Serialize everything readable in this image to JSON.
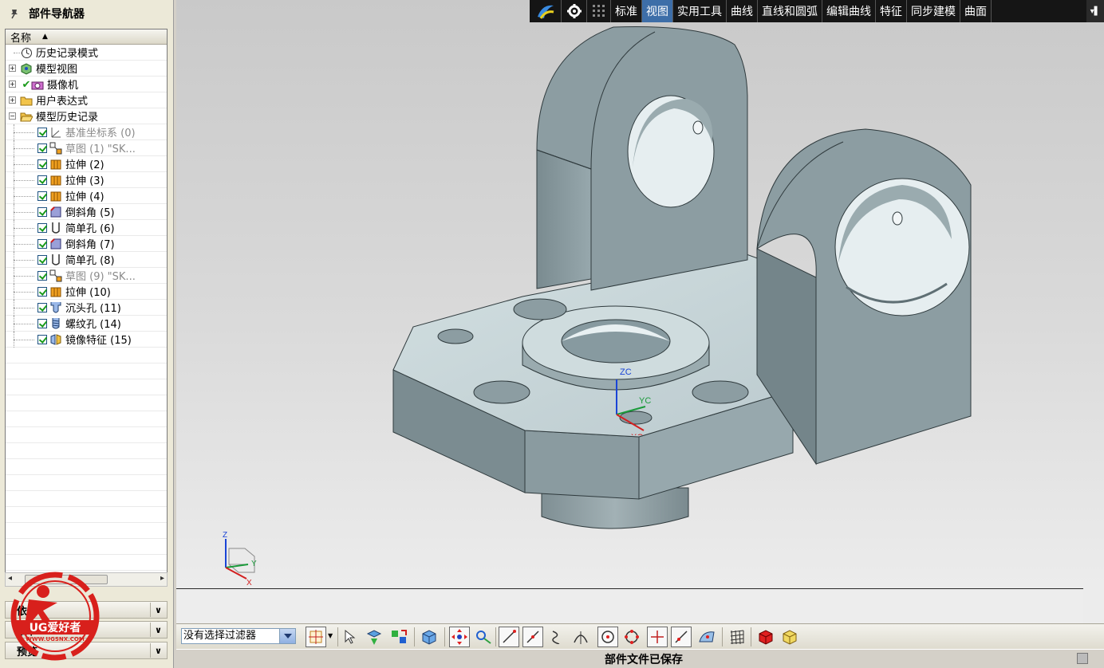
{
  "navigator": {
    "title": "部件导航器",
    "column_name": "名称",
    "items": [
      {
        "label": "历史记录模式",
        "icon": "clock-icon",
        "level": 0,
        "expander": "",
        "checked": false,
        "gray": false
      },
      {
        "label": "模型视图",
        "icon": "model-view-icon",
        "level": 0,
        "expander": "+",
        "checked": false,
        "gray": false
      },
      {
        "label": "摄像机",
        "icon": "camera-icon",
        "level": 0,
        "expander": "+",
        "checked": false,
        "gray": false
      },
      {
        "label": "用户表达式",
        "icon": "folder-icon",
        "level": 0,
        "expander": "+",
        "checked": false,
        "gray": false
      },
      {
        "label": "模型历史记录",
        "icon": "folder-open-icon",
        "level": 0,
        "expander": "-",
        "checked": false,
        "gray": false
      },
      {
        "label": "基准坐标系 (0)",
        "icon": "datum-csys-icon",
        "level": 1,
        "expander": "",
        "checked": true,
        "gray": true
      },
      {
        "label": "草图 (1) \"SK...",
        "icon": "sketch-icon",
        "level": 1,
        "expander": "",
        "checked": true,
        "gray": true
      },
      {
        "label": "拉伸 (2)",
        "icon": "extrude-icon",
        "level": 1,
        "expander": "",
        "checked": true,
        "gray": false
      },
      {
        "label": "拉伸 (3)",
        "icon": "extrude-icon",
        "level": 1,
        "expander": "",
        "checked": true,
        "gray": false
      },
      {
        "label": "拉伸 (4)",
        "icon": "extrude-icon",
        "level": 1,
        "expander": "",
        "checked": true,
        "gray": false
      },
      {
        "label": "倒斜角 (5)",
        "icon": "chamfer-icon",
        "level": 1,
        "expander": "",
        "checked": true,
        "gray": false
      },
      {
        "label": "简单孔 (6)",
        "icon": "simple-hole-icon",
        "level": 1,
        "expander": "",
        "checked": true,
        "gray": false
      },
      {
        "label": "倒斜角 (7)",
        "icon": "chamfer-icon",
        "level": 1,
        "expander": "",
        "checked": true,
        "gray": false
      },
      {
        "label": "简单孔 (8)",
        "icon": "simple-hole-icon",
        "level": 1,
        "expander": "",
        "checked": true,
        "gray": false
      },
      {
        "label": "草图 (9) \"SK...",
        "icon": "sketch-icon",
        "level": 1,
        "expander": "",
        "checked": true,
        "gray": true
      },
      {
        "label": "拉伸 (10)",
        "icon": "extrude-icon",
        "level": 1,
        "expander": "",
        "checked": true,
        "gray": false
      },
      {
        "label": "沉头孔 (11)",
        "icon": "counterbore-hole-icon",
        "level": 1,
        "expander": "",
        "checked": true,
        "gray": false
      },
      {
        "label": "螺纹孔 (14)",
        "icon": "threaded-hole-icon",
        "level": 1,
        "expander": "",
        "checked": true,
        "gray": false
      },
      {
        "label": "镜像特征 (15)",
        "icon": "mirror-feature-icon",
        "level": 1,
        "expander": "",
        "checked": true,
        "gray": false
      }
    ],
    "panels": [
      "依性",
      "细节",
      "预览"
    ]
  },
  "top_menu": {
    "items": [
      "标准",
      "视图",
      "实用工具",
      "曲线",
      "直线和圆弧",
      "编辑曲线",
      "特征",
      "同步建模",
      "曲面"
    ],
    "active": "视图"
  },
  "viewport": {
    "wcs_labels": {
      "zc": "ZC",
      "yc": "YC",
      "xc": "XC"
    },
    "abs_triad_labels": {
      "z": "Z",
      "y": "Y",
      "x": "X"
    }
  },
  "toolbar": {
    "filter_value": "没有选择过滤器"
  },
  "status": {
    "message": "部件文件已保存"
  },
  "watermark": {
    "brand": "UG爱好者",
    "url": "WWW.UGSNX.COM"
  },
  "colors": {
    "menu_bg": "#151515",
    "menu_active": "#3d6ea8",
    "part_light": "#c8d6d8",
    "part_mid": "#8fa1a6",
    "part_dark": "#6f7f84",
    "watermark_red": "#d8201c"
  }
}
